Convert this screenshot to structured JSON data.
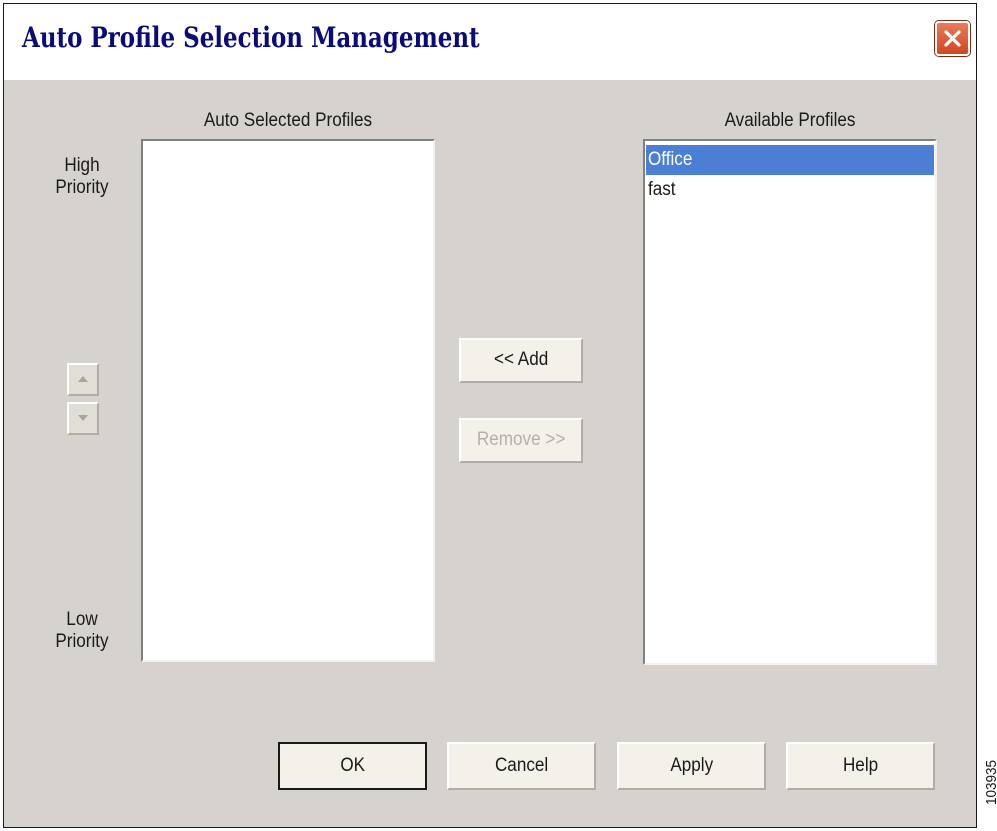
{
  "window": {
    "title": "Auto Profile Selection Management",
    "close_icon": "close-x-icon"
  },
  "priority": {
    "high_line1": "High",
    "high_line2": "Priority",
    "low_line1": "Low",
    "low_line2": "Priority",
    "move_up_icon": "arrow-up-icon",
    "move_down_icon": "arrow-down-icon"
  },
  "auto_selected": {
    "label": "Auto Selected Profiles",
    "items": []
  },
  "available": {
    "label": "Available Profiles",
    "items": [
      {
        "label": "Office",
        "selected": true
      },
      {
        "label": "fast",
        "selected": false
      }
    ]
  },
  "actions": {
    "add_label": "<< Add",
    "remove_label": "Remove >>"
  },
  "footer": {
    "ok_label": "OK",
    "cancel_label": "Cancel",
    "apply_label": "Apply",
    "help_label": "Help"
  },
  "figure_id": "103935",
  "colors": {
    "dialog_bg": "#d6d3ce",
    "title_text": "#0a0a7a",
    "selection": "#4a7fd4",
    "close_button": "#d9572f"
  }
}
